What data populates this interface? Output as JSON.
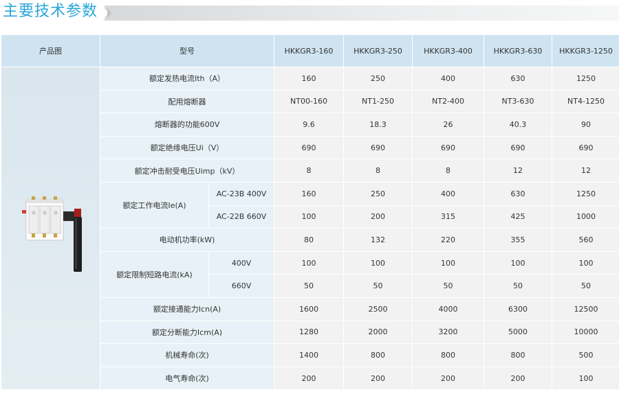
{
  "page": {
    "title": "主要技术参数"
  },
  "table": {
    "header": {
      "image_col": "产品图",
      "model_col": "型号",
      "models": [
        "HKKGR3-160",
        "HKKGR3-250",
        "HKKGR3-400",
        "HKKGR3-630",
        "HKKGR3-1250"
      ]
    },
    "rows": [
      {
        "label": "额定发热电流Ith（A）",
        "values": [
          "160",
          "250",
          "400",
          "630",
          "1250"
        ]
      },
      {
        "label": "配用熔断器",
        "values": [
          "NT00-160",
          "NT1-250",
          "NT2-400",
          "NT3-630",
          "NT4-1250"
        ]
      },
      {
        "label": "熔断器的功能600V",
        "values": [
          "9.6",
          "18.3",
          "26",
          "40.3",
          "90"
        ]
      },
      {
        "label": "额定绝缘电压Ui（V）",
        "values": [
          "690",
          "690",
          "690",
          "690",
          "690"
        ]
      },
      {
        "label": "额定冲击耐受电压Uimp（kV）",
        "values": [
          "8",
          "8",
          "8",
          "12",
          "12"
        ]
      }
    ],
    "operating_current": {
      "label": "额定工作电流Ie(A)",
      "rows": [
        {
          "sub": "AC-23B 400V",
          "values": [
            "160",
            "250",
            "400",
            "630",
            "1250"
          ]
        },
        {
          "sub": "AC-22B 660V",
          "values": [
            "100",
            "200",
            "315",
            "425",
            "1000"
          ]
        }
      ]
    },
    "motor_power": {
      "label": "电动机功率(kW)",
      "values": [
        "80",
        "132",
        "220",
        "355",
        "560"
      ]
    },
    "short_circuit": {
      "label": "额定限制短路电流(kA)",
      "rows": [
        {
          "sub": "400V",
          "values": [
            "100",
            "100",
            "100",
            "100",
            "100"
          ]
        },
        {
          "sub": "660V",
          "values": [
            "50",
            "50",
            "50",
            "50",
            "50"
          ]
        }
      ]
    },
    "tail_rows": [
      {
        "label": "额定接通能力Icn(A)",
        "values": [
          "1600",
          "2500",
          "4000",
          "6300",
          "12500"
        ]
      },
      {
        "label": "额定分断能力Icm(A)",
        "values": [
          "1280",
          "2000",
          "3200",
          "5000",
          "10000"
        ]
      },
      {
        "label": "机械寿命(次)",
        "values": [
          "1400",
          "800",
          "800",
          "800",
          "500"
        ]
      },
      {
        "label": "电气寿命(次)",
        "values": [
          "200",
          "200",
          "200",
          "200",
          "100"
        ]
      }
    ]
  }
}
